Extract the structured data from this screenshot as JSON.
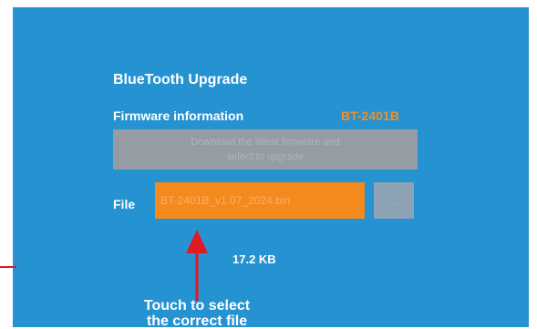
{
  "dialog": {
    "title": "BlueTooth Upgrade",
    "firmware_label": "Firmware information",
    "firmware_model": "BT-2401B",
    "info_text_line1": "Download the latest firmware and",
    "info_text_line2": "select to upgrade",
    "file_label": "File",
    "file_value": "BT-2401B_v1.07_2024.bin",
    "browse_label": "...",
    "file_size": "17.2 KB"
  },
  "annotation": {
    "text_line1": "Touch to select",
    "text_line2": "the correct file"
  },
  "colors": {
    "background": "#2592d2",
    "accent": "#f48a1e",
    "arrow": "#e01a24"
  }
}
